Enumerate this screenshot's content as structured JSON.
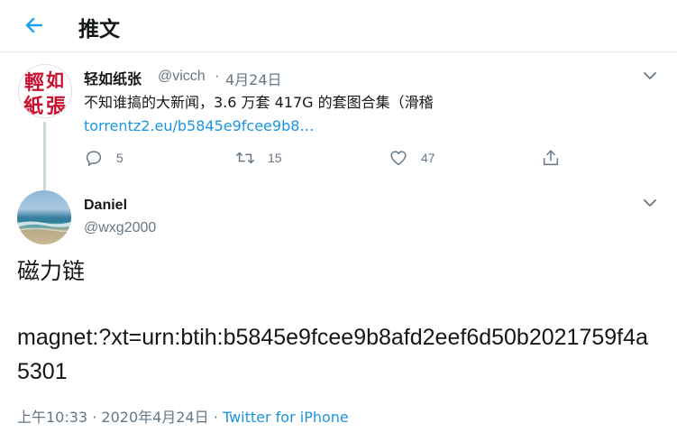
{
  "header": {
    "title": "推文",
    "back_icon": "arrow-left-icon",
    "accent": "#1da1f2"
  },
  "parent_tweet": {
    "avatar_text": "輕如紙張",
    "author_name": "轻如纸张",
    "author_handle": "@vicch",
    "separator": "·",
    "date": "4月24日",
    "text": "不知谁搞的大新闻，3.6 万套 417G 的套图合集（滑稽 ",
    "link_text": "torrentz2.eu/b5845e9fcee9b8…",
    "replies": "5",
    "retweets": "15",
    "likes": "47"
  },
  "main_tweet": {
    "author_name": "Daniel",
    "author_handle": "@wxg2000",
    "text": "磁力链",
    "magnet": "magnet:?xt=urn:btih:b5845e9fcee9b8afd2eef6d50b2021759f4a5301",
    "time": "上午10:33",
    "separator": "·",
    "date": "2020年4月24日",
    "source": "Twitter for iPhone"
  },
  "colors": {
    "link": "#1b95e0",
    "muted": "#657786",
    "text": "#14171a",
    "border": "#e6ecf0"
  }
}
